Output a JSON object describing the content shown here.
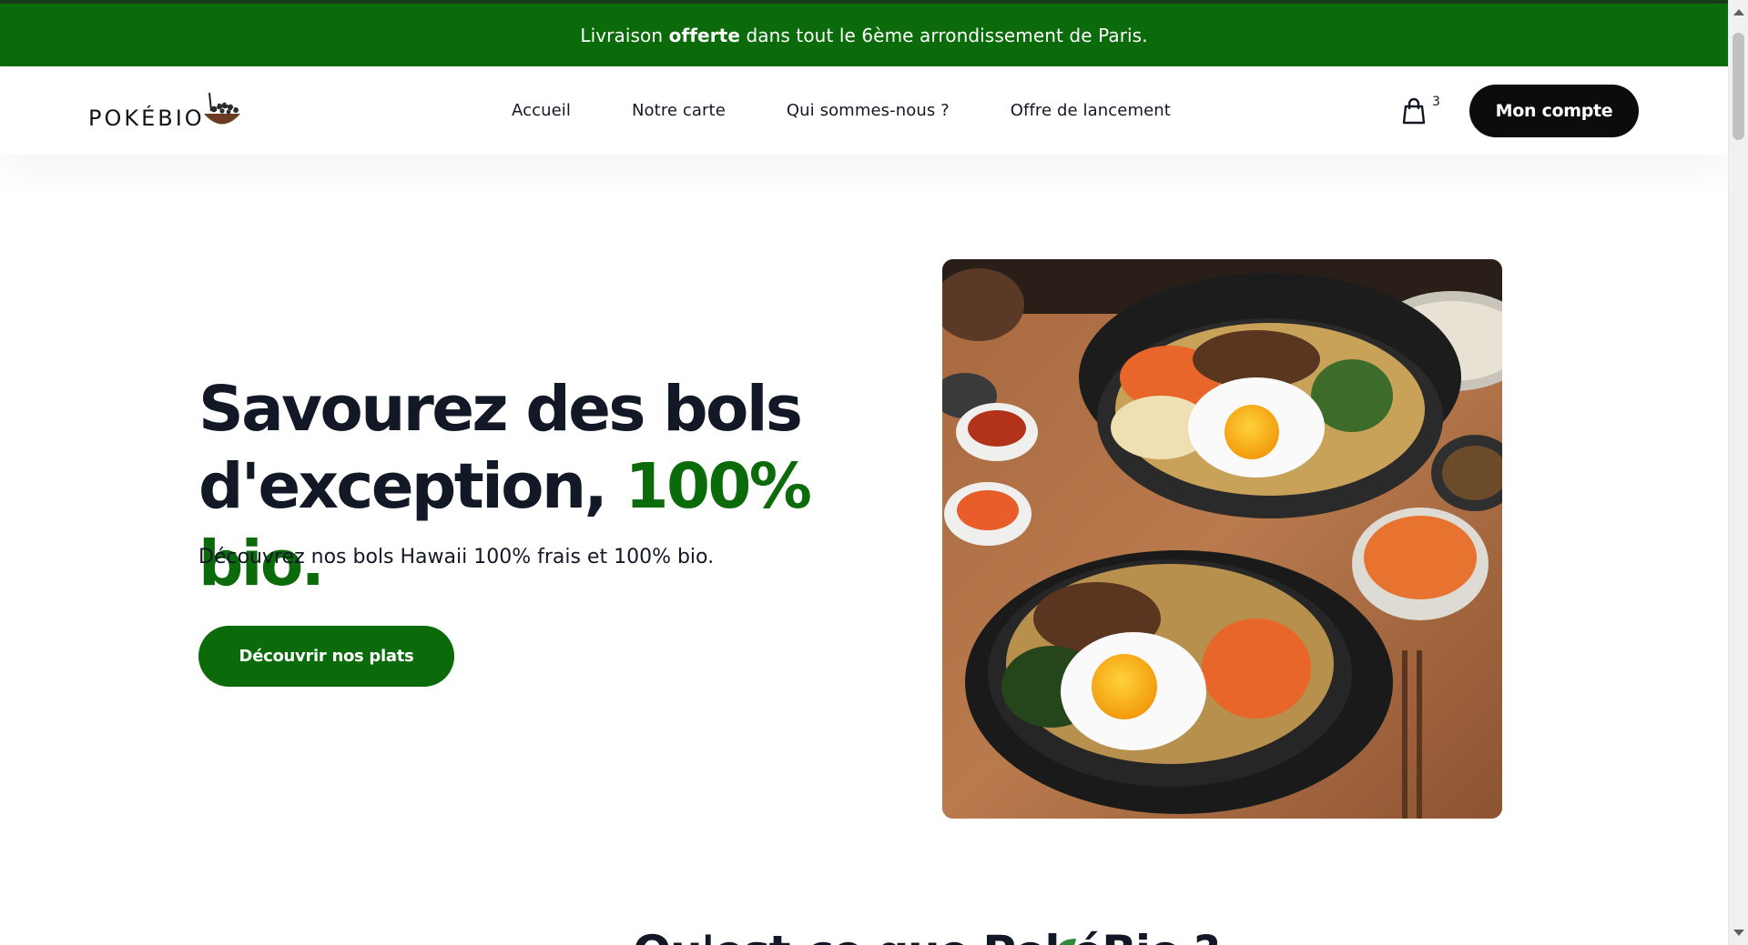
{
  "announcement": {
    "prefix": "Livraison",
    "bold": "offerte",
    "suffix": "dans tout le 6ème arrondissement de Paris."
  },
  "brand": {
    "logo_text": "POKÉBIO",
    "primary_color": "#0b6b0b",
    "dark_color": "#121826"
  },
  "nav": {
    "items": [
      "Accueil",
      "Notre carte",
      "Qui sommes-nous ?",
      "Offre de lancement"
    ]
  },
  "cart": {
    "icon": "shopping-bag-icon",
    "count": "3"
  },
  "account": {
    "label": "Mon compte"
  },
  "hero": {
    "title_line1": "Savourez des bols",
    "title_line2": "d'exception,",
    "title_accent": "100% bio.",
    "subtitle": "Découvrez nos bols Hawaii 100% frais et 100% bio.",
    "cta_label": "Découvrir nos plats",
    "image": "bibimbap-bowls-photo"
  },
  "next_section": {
    "title_peek": "Qu'est-ce que PokéBio ?"
  }
}
